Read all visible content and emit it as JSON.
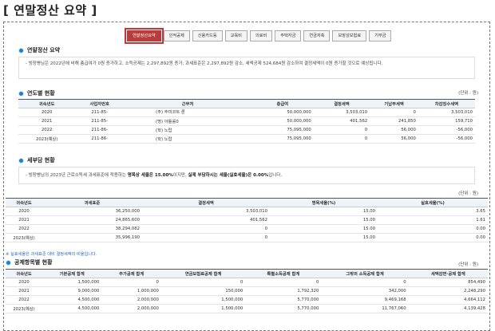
{
  "page_title": "[ 연말정산 요약 ]",
  "tabs": [
    "연말정산요약",
    "인적공제",
    "신용카드등",
    "교육비",
    "의료비",
    "주택자금",
    "연금저축",
    "보장성보험료",
    "기부금"
  ],
  "sections": {
    "summary": {
      "title": "연말정산 요약",
      "text": "- 빙장병님은 2022년에 비해 총급여가 0원 증가하고, 소득공제는 2,297,892원 증가, 과세표준은 2,297,892원 감소, 세액공제 524,684원 감소하여 결정세액이 0원 증가할 것으로 예상됩니다."
    },
    "yearly": {
      "title": "연도별 현황",
      "unit": "(단위 : 원)",
      "headers": [
        "귀속년도",
        "사업자번호",
        "근무처",
        "총급여",
        "결정세액",
        "기납부세액",
        "차감징수세액"
      ],
      "rows": [
        [
          "2020",
          "211-85-",
          "(주) 주미코트 론",
          "50,000,000",
          "3,503,010",
          "0",
          "3,503,010"
        ],
        [
          "2021",
          "211-85-",
          "(명) 아틀롤0",
          "50,000,000",
          "401,562",
          "241,850",
          "159,710"
        ],
        [
          "2022",
          "211-86-",
          "(학) 노랍",
          "75,095,000",
          "0",
          "56,000",
          "-56,000"
        ],
        [
          "2023(예상)",
          "211-86-",
          "(학) 노랍",
          "75,095,000",
          "0",
          "56,000",
          "-56,000"
        ]
      ]
    },
    "tax_burden": {
      "title": "세부담 현황",
      "text_pre": "- 빙장병님의 2023년 근로소득세 과세표준에 적용하는 ",
      "text_b1": "명목상 세율은 15.00%",
      "text_mid": "이지만, ",
      "text_b2": "실제 부담하시는 세율(실효세율)은 0.00%",
      "text_post": "입니다.",
      "unit": "(단위 : 원)",
      "headers": [
        "귀속년도",
        "과세표준",
        "결정세액",
        "명목세율(%)",
        "실효세율(%)"
      ],
      "rows": [
        [
          "2020",
          "36,250,000",
          "3,503,010",
          "15.00",
          "3.65"
        ],
        [
          "2021",
          "24,865,600",
          "401,562",
          "15.00",
          "1.61"
        ],
        [
          "2022",
          "38,294,082",
          "0",
          "15.00",
          "0.00"
        ],
        [
          "2023(예상)",
          "35,996,190",
          "0",
          "15.00",
          "0.00"
        ]
      ],
      "note": "※ 실효세율은 과세표준 대비 결정세액의 비율입니다."
    },
    "deductions": {
      "title": "공제항목별 현황",
      "unit": "(단위 : 원)",
      "headers": [
        "귀속년도",
        "기본공제 합계",
        "추가공제 합계",
        "연금보험료공제 합계",
        "특별소득공제 합계",
        "그밖의 소득공제 합계",
        "세액감면·공제 합계"
      ],
      "rows": [
        [
          "2020",
          "1,500,000",
          "0",
          "0",
          "0",
          "0",
          "854,490"
        ],
        [
          "2021",
          "9,000,000",
          "1,000,000",
          "150,000",
          "1,792,320",
          "342,000",
          "2,248,290"
        ],
        [
          "2022",
          "4,500,000",
          "2,000,000",
          "1,500,000",
          "5,770,000",
          "9,469,168",
          "4,664,112"
        ],
        [
          "2023(예상)",
          "4,500,000",
          "2,000,000",
          "1,500,000",
          "5,770,000",
          "11,767,060",
          "4,139,428"
        ]
      ]
    }
  }
}
